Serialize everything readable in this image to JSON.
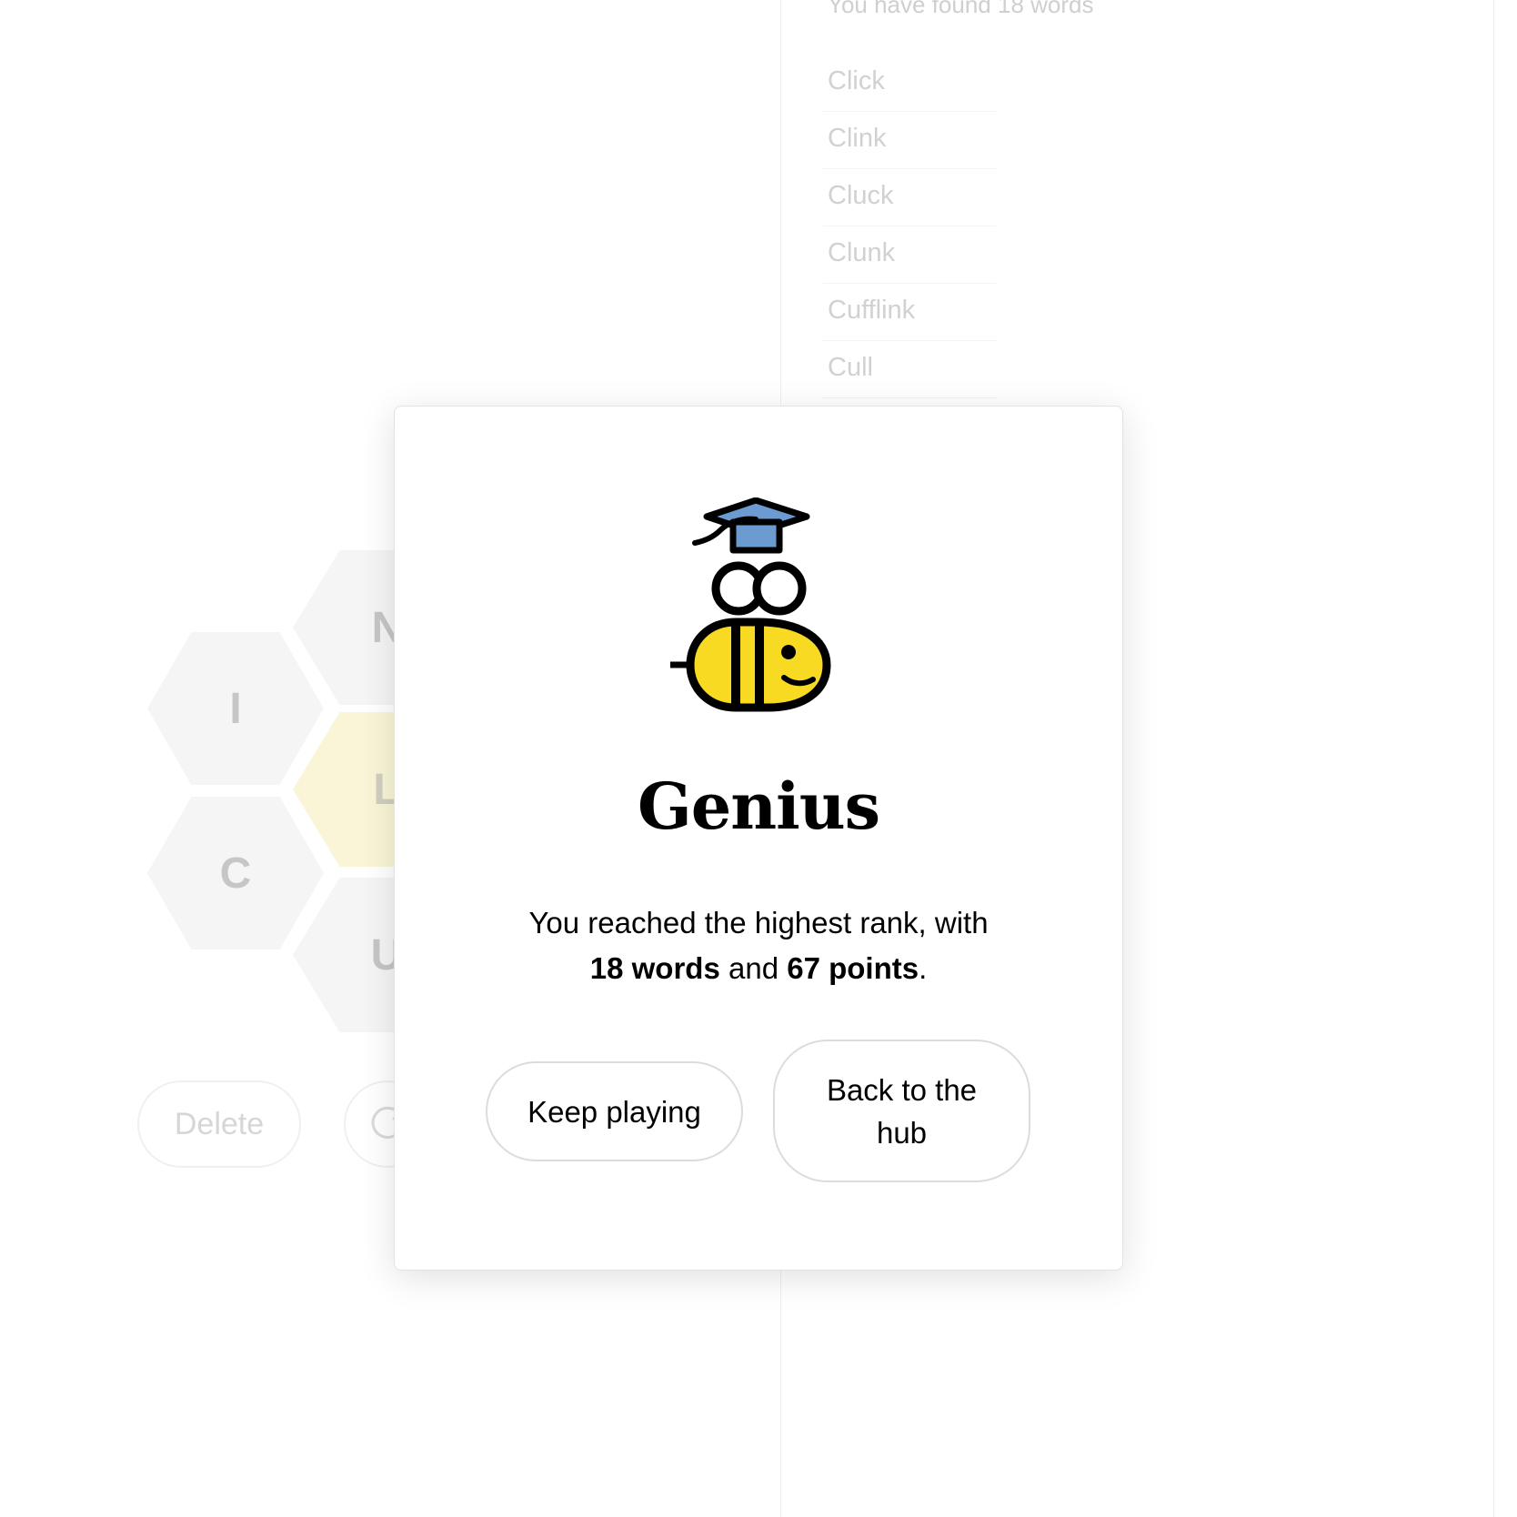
{
  "background": {
    "found_count_text": "You have found 18 words",
    "words": [
      "Click",
      "Clink",
      "Cluck",
      "Clunk",
      "Cufflink",
      "Cull"
    ],
    "hive_letters": {
      "top": "N",
      "upper_left": "I",
      "center": "L",
      "lower_left": "C",
      "bottom": "U"
    },
    "delete_label": "Delete",
    "shuffle_icon": "shuffle-icon"
  },
  "modal": {
    "icon": "genius-bee-graduation-cap-icon",
    "rank_title": "Genius",
    "message_prefix": "You reached the highest rank, with",
    "words_count": "18 words",
    "and_text": "and",
    "points_count": "67 points",
    "period": ".",
    "keep_playing_label": "Keep playing",
    "back_to_hub_label": "Back to the hub"
  },
  "colors": {
    "bee_yellow": "#f7da21",
    "cap_blue": "#6c9bd2",
    "center_hex": "#f8f4cf",
    "outer_hex": "#f4f4f4"
  }
}
